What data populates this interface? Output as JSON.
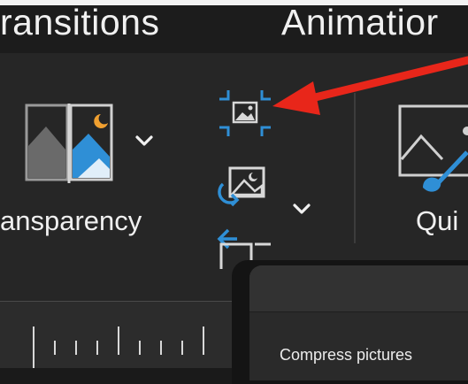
{
  "tabs": {
    "left_label": "ransitions",
    "right_label": "Animatior"
  },
  "groups": {
    "transparency_label": "ansparency",
    "quick_styles_label": "Qui"
  },
  "icons": {
    "transparency": "transparency-icon",
    "transparency_dropdown": "chevron-down-icon",
    "crop": "crop-picture-icon",
    "change_picture": "change-picture-icon",
    "change_picture_dropdown": "chevron-down-icon",
    "reset_picture": "reset-picture-icon",
    "quick_styles": "quick-styles-icon",
    "annotation_arrow": "red-arrow-icon"
  },
  "dialog": {
    "text": "Compress pictures"
  },
  "colors": {
    "accent_blue": "#2f8fd6",
    "annotation_red": "#e8261a",
    "moon_orange": "#f0a030",
    "ribbon_bg": "#262626"
  }
}
